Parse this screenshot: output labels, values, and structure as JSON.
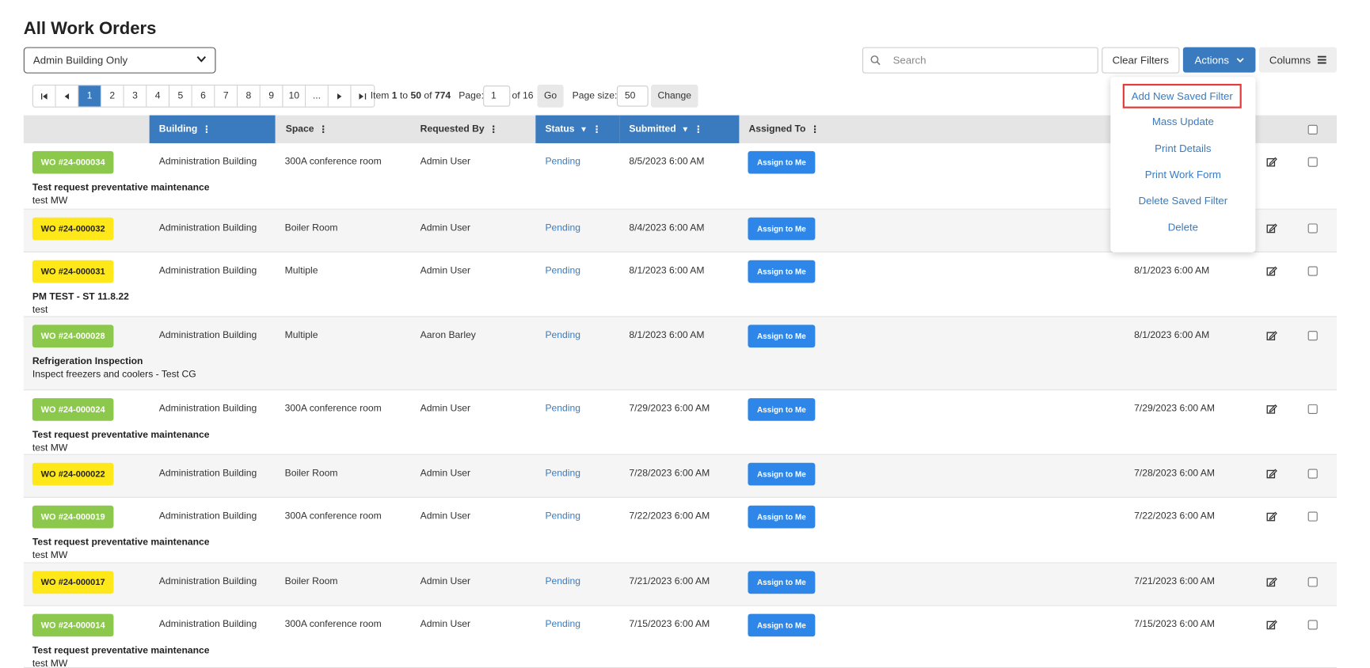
{
  "page": {
    "title": "All Work Orders"
  },
  "filter_select": {
    "value": "Admin Building Only"
  },
  "search": {
    "placeholder": "Search"
  },
  "toolbar": {
    "clear_filters": "Clear Filters",
    "actions": "Actions",
    "columns": "Columns"
  },
  "pager": {
    "pages": [
      "1",
      "2",
      "3",
      "4",
      "5",
      "6",
      "7",
      "8",
      "9",
      "10",
      "..."
    ],
    "item_label": "Item",
    "item_from": "1",
    "to_label": "to",
    "item_to": "50",
    "of_label": "of",
    "total": "774",
    "page_label": "Page:",
    "page_value": "1",
    "of_pages": "of 16",
    "go": "Go",
    "page_size_label": "Page size:",
    "page_size": "50",
    "change": "Change"
  },
  "headers": {
    "building": "Building",
    "space": "Space",
    "requested_by": "Requested By",
    "status": "Status",
    "submitted": "Submitted",
    "assigned_to": "Assigned To"
  },
  "assign_label": "Assign to Me",
  "rows": [
    {
      "wo": "WO #24-000034",
      "color": "green",
      "building": "Administration Building",
      "space": "300A conference room",
      "requested_by": "Admin User",
      "status": "Pending",
      "submitted": "8/5/2023 6:00 AM",
      "date2": "",
      "desc_title": "Test request preventative maintenance",
      "desc_sub": "test MW"
    },
    {
      "wo": "WO #24-000032",
      "color": "yellow",
      "building": "Administration Building",
      "space": "Boiler Room",
      "requested_by": "Admin User",
      "status": "Pending",
      "submitted": "8/4/2023 6:00 AM",
      "date2": "",
      "desc_title": "",
      "desc_sub": ""
    },
    {
      "wo": "WO #24-000031",
      "color": "yellow",
      "building": "Administration Building",
      "space": "Multiple",
      "requested_by": "Admin User",
      "status": "Pending",
      "submitted": "8/1/2023 6:00 AM",
      "date2": "8/1/2023 6:00 AM",
      "desc_title": "PM TEST - ST 11.8.22",
      "desc_sub": "test"
    },
    {
      "wo": "WO #24-000028",
      "color": "green",
      "building": "Administration Building",
      "space": "Multiple",
      "requested_by": "Aaron Barley",
      "status": "Pending",
      "submitted": "8/1/2023 6:00 AM",
      "date2": "8/1/2023 6:00 AM",
      "desc_title": "Refrigeration Inspection",
      "desc_sub": "Inspect freezers and coolers - Test CG"
    },
    {
      "wo": "WO #24-000024",
      "color": "green",
      "building": "Administration Building",
      "space": "300A conference room",
      "requested_by": "Admin User",
      "status": "Pending",
      "submitted": "7/29/2023 6:00 AM",
      "date2": "7/29/2023 6:00 AM",
      "desc_title": "Test request preventative maintenance",
      "desc_sub": "test MW"
    },
    {
      "wo": "WO #24-000022",
      "color": "yellow",
      "building": "Administration Building",
      "space": "Boiler Room",
      "requested_by": "Admin User",
      "status": "Pending",
      "submitted": "7/28/2023 6:00 AM",
      "date2": "7/28/2023 6:00 AM",
      "desc_title": "",
      "desc_sub": ""
    },
    {
      "wo": "WO #24-000019",
      "color": "green",
      "building": "Administration Building",
      "space": "300A conference room",
      "requested_by": "Admin User",
      "status": "Pending",
      "submitted": "7/22/2023 6:00 AM",
      "date2": "7/22/2023 6:00 AM",
      "desc_title": "Test request preventative maintenance",
      "desc_sub": "test MW"
    },
    {
      "wo": "WO #24-000017",
      "color": "yellow",
      "building": "Administration Building",
      "space": "Boiler Room",
      "requested_by": "Admin User",
      "status": "Pending",
      "submitted": "7/21/2023 6:00 AM",
      "date2": "7/21/2023 6:00 AM",
      "desc_title": "",
      "desc_sub": ""
    },
    {
      "wo": "WO #24-000014",
      "color": "green",
      "building": "Administration Building",
      "space": "300A conference room",
      "requested_by": "Admin User",
      "status": "Pending",
      "submitted": "7/15/2023 6:00 AM",
      "date2": "7/15/2023 6:00 AM",
      "desc_title": "Test request preventative maintenance",
      "desc_sub": "test MW"
    }
  ],
  "actions_menu": [
    "Add New Saved Filter",
    "Mass Update",
    "Print Details",
    "Print Work Form",
    "Delete Saved Filter",
    "Delete"
  ],
  "colors": {
    "primary": "#3a7bbf",
    "assign": "#2e87e8",
    "green_badge": "#8cc84b",
    "yellow_badge": "#ffe81a",
    "highlight": "#e23b3b"
  }
}
